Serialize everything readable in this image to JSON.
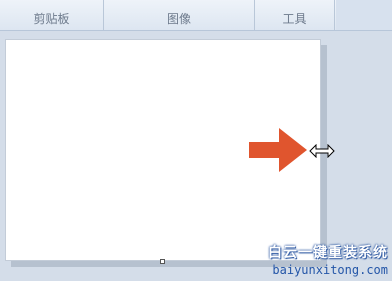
{
  "ribbon": {
    "groups": [
      "剪贴板",
      "图像",
      "工具"
    ]
  },
  "canvas": {
    "background": "#ffffff"
  },
  "annotation": {
    "arrow_color": "#e0552e",
    "arrow_icon": "right-arrow-icon",
    "cursor_icon": "horizontal-resize-cursor-icon"
  },
  "watermark": {
    "title": "白云一键重装系统",
    "url": "baiyunxitong.com"
  }
}
